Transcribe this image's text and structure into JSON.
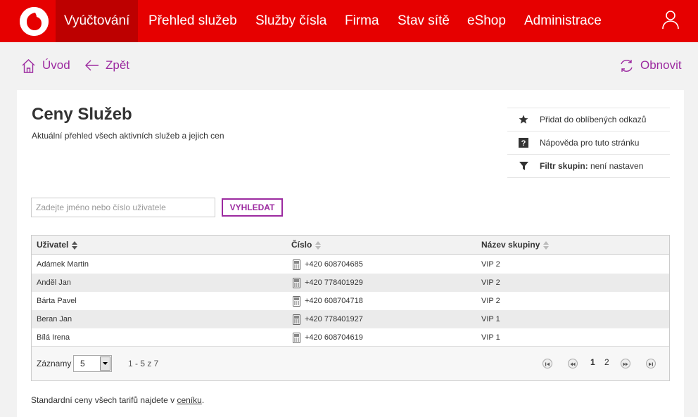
{
  "nav": {
    "items": [
      {
        "label": "Vyúčtování",
        "active": true
      },
      {
        "label": "Přehled služeb"
      },
      {
        "label": "Služby čísla"
      },
      {
        "label": "Firma"
      },
      {
        "label": "Stav sítě"
      },
      {
        "label": "eShop"
      },
      {
        "label": "Administrace"
      }
    ]
  },
  "toolbar": {
    "home_label": "Úvod",
    "back_label": "Zpět",
    "refresh_label": "Obnovit"
  },
  "page": {
    "title": "Ceny Služeb",
    "subtitle": "Aktuální přehled všech aktivních služeb a jejich cen"
  },
  "side_links": {
    "favorite": "Přidat do oblíbených odkazů",
    "help": "Nápověda pro tuto stránku",
    "filter_label": "Filtr skupin:",
    "filter_value": " není nastaven"
  },
  "search": {
    "placeholder": "Zadejte jméno nebo číslo uživatele",
    "button": "VYHLEDAT"
  },
  "table": {
    "columns": [
      "Uživatel",
      "Číslo",
      "Název skupiny"
    ],
    "rows": [
      {
        "user": "Adámek Martin",
        "number": "+420 608704685",
        "group": "VIP 2"
      },
      {
        "user": "Anděl Jan",
        "number": "+420 778401929",
        "group": "VIP 2"
      },
      {
        "user": "Bárta Pavel",
        "number": "+420 608704718",
        "group": "VIP 2"
      },
      {
        "user": "Beran Jan",
        "number": "+420 778401927",
        "group": "VIP 1"
      },
      {
        "user": "Bílá Irena",
        "number": "+420 608704619",
        "group": "VIP 1"
      }
    ],
    "pager": {
      "records_label": "Záznamy",
      "page_size": "5",
      "range": "1 - 5 z 7",
      "pages": [
        "1",
        "2"
      ],
      "current_page": "1"
    }
  },
  "footer": {
    "text_before": "Standardní ceny všech tarifů najdete v ",
    "link": "ceníku",
    "text_after": "."
  },
  "colors": {
    "brand_red": "#e60000",
    "active_tab": "#bd0000",
    "accent_purple": "#9c2aa0"
  }
}
